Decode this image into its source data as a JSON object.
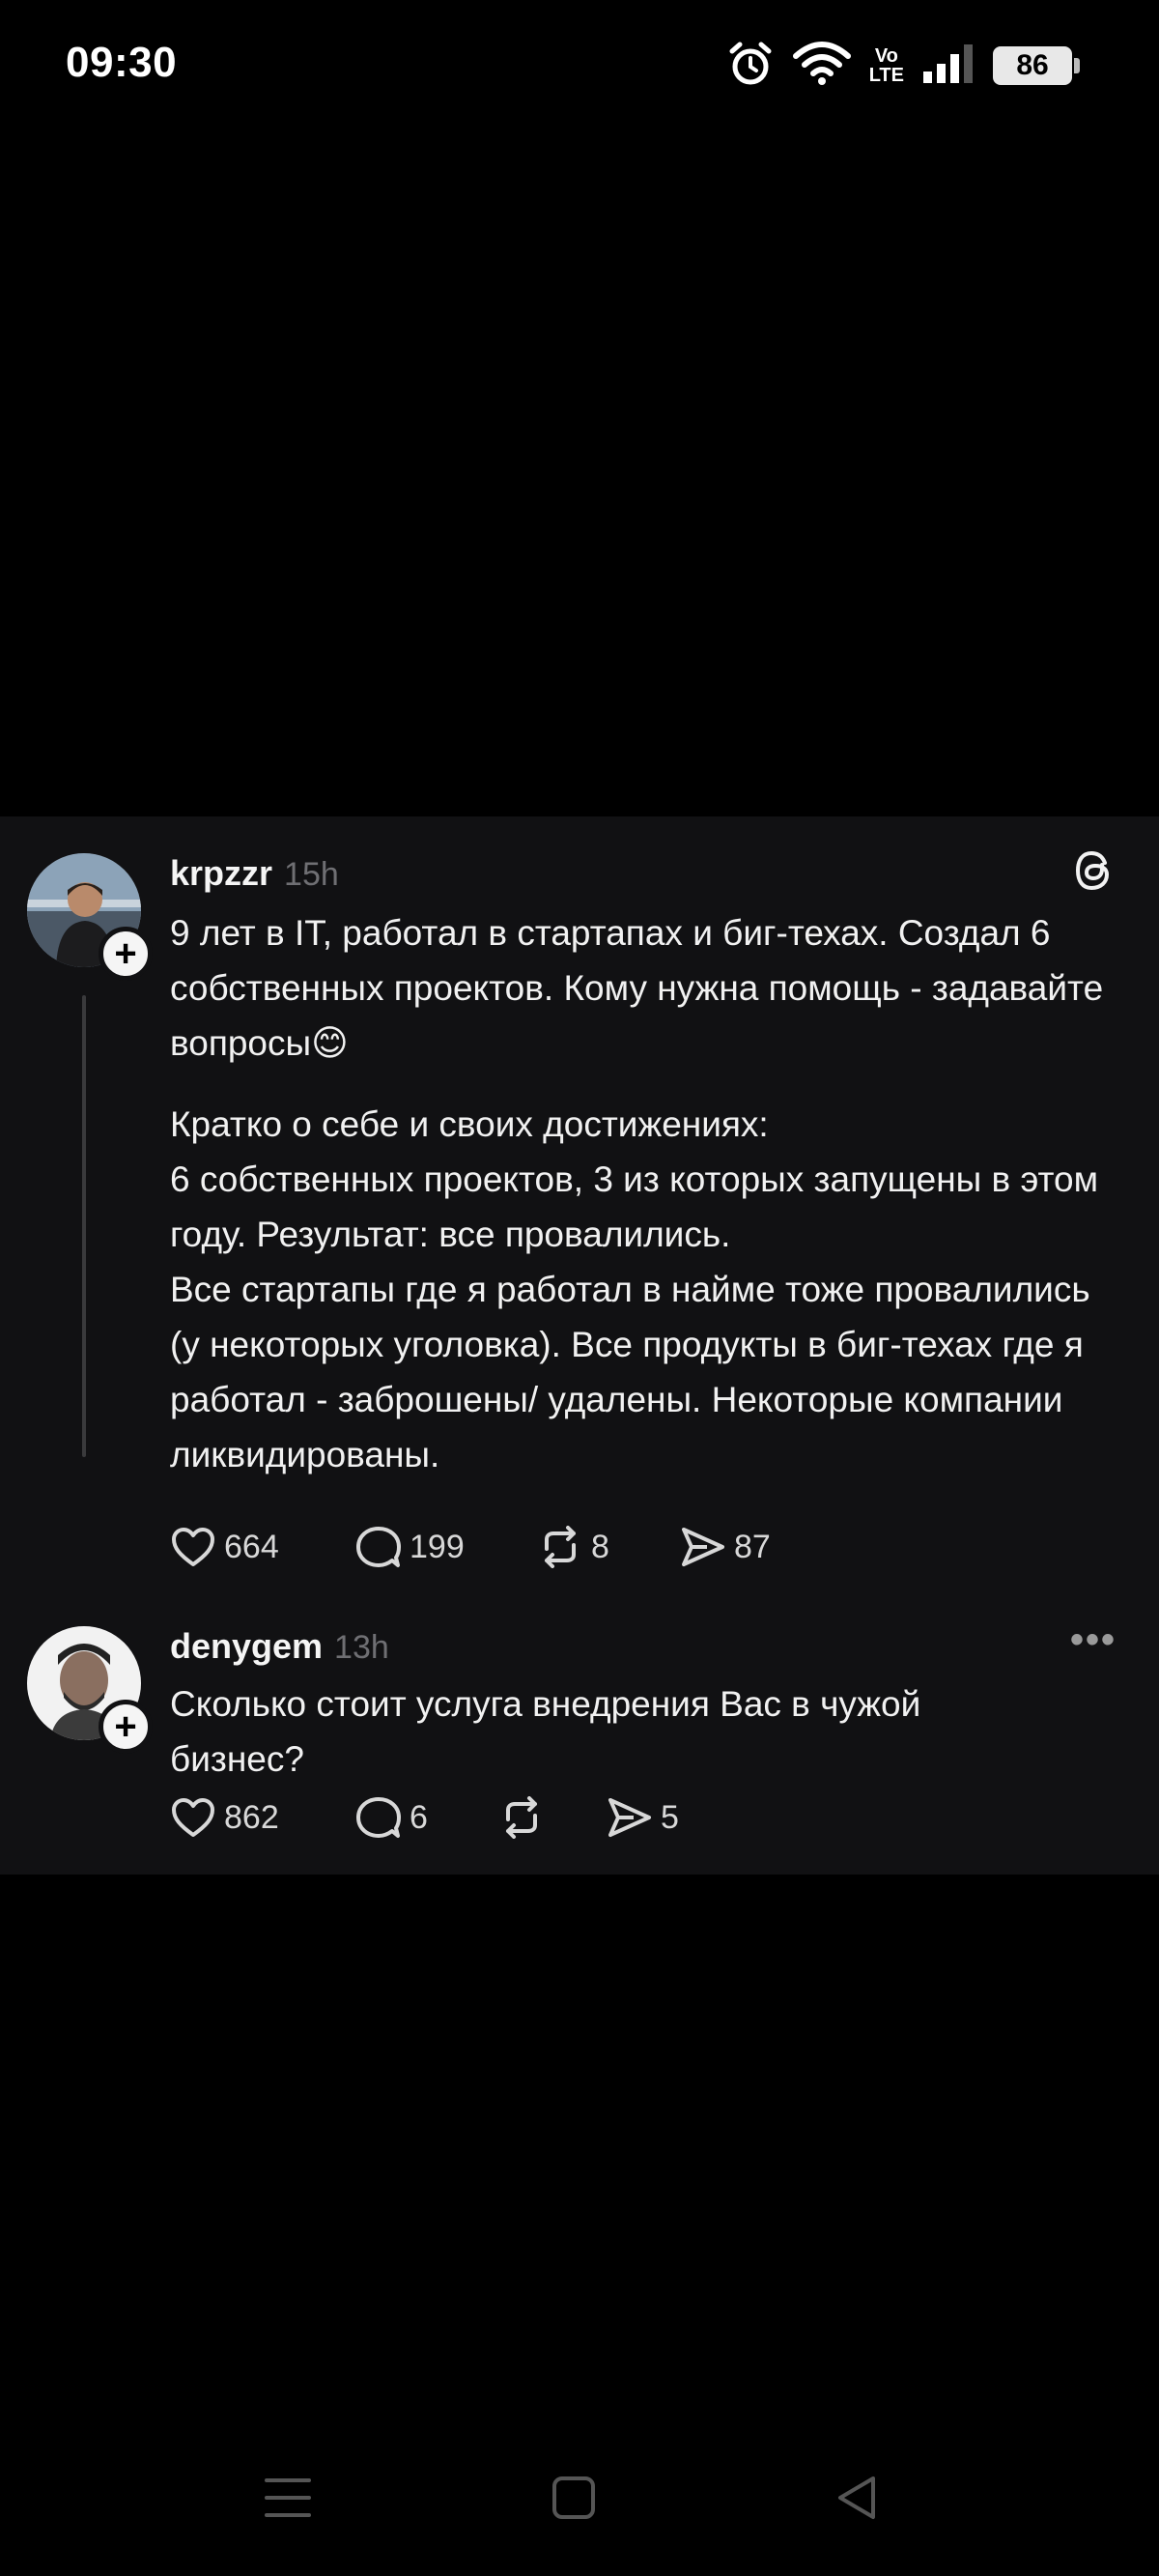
{
  "status_bar": {
    "time": "09:30",
    "battery": "86",
    "network_top": "Vo",
    "network_bottom": "LTE",
    "icons": [
      "alarm-icon",
      "wifi-icon",
      "volte-icon",
      "signal-icon",
      "battery-icon"
    ]
  },
  "posts": [
    {
      "username": "krpzzr",
      "time": "15h",
      "paragraphs": [
        "9 лет в IT, работал в стартапах и биг-техах. Создал 6 собственных проектов. Кому нужна помощь - задавайте вопросы😊",
        "Кратко о себе и своих достижениях:",
        "6 собственных проектов, 3 из которых запущены в этом году. Результат: все провалились.",
        "Все стартапы где я работал в найме тоже провалились (у некоторых уголовка). Все продукты в биг-техах где я работал - заброшены/ удалены. Некоторые компании ликвидированы."
      ],
      "likes": "664",
      "replies": "199",
      "reposts": "8",
      "shares": "87"
    },
    {
      "username": "denygem",
      "time": "13h",
      "paragraphs": [
        "Сколько стоит услуга внедрения Вас в чужой бизнес?"
      ],
      "likes": "862",
      "replies": "6",
      "reposts": "",
      "shares": "5"
    }
  ],
  "colors": {
    "background": "#000000",
    "card": "#111113",
    "text": "#f1f1f1",
    "muted": "#6f6f73"
  }
}
